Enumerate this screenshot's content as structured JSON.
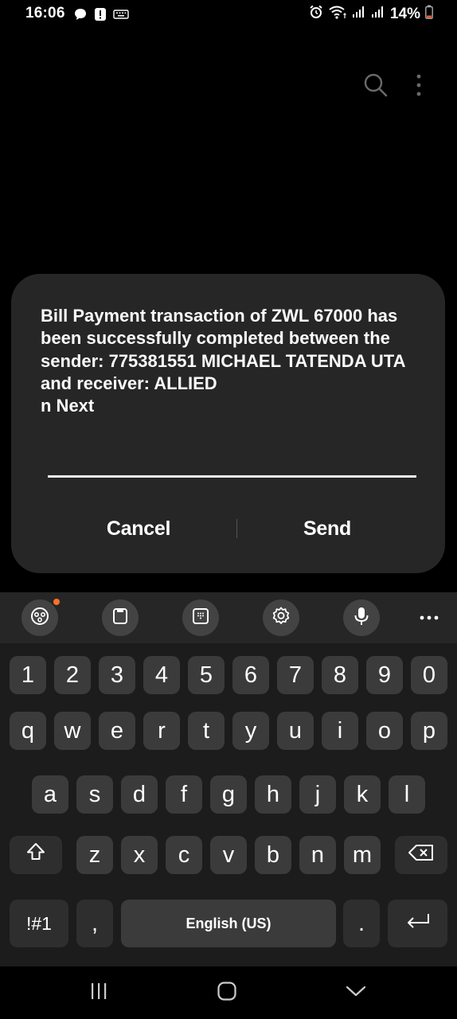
{
  "status_bar": {
    "time": "16:06",
    "battery": "14%",
    "left_icons": [
      "chat-bubble-icon",
      "alert-icon",
      "keyboard-icon"
    ],
    "right_icons": [
      "alarm-icon",
      "wifi-icon",
      "signal-icon",
      "signal-icon",
      "battery-low-icon"
    ]
  },
  "top_actions": {
    "icons": [
      "search-icon",
      "more-vertical-icon"
    ]
  },
  "dialog": {
    "message": "Bill Payment transaction of ZWL 67000 has been successfully completed between the sender: 775381551 MICHAEL TATENDA UTA and receiver: ALLIED\nn Next",
    "cancel_label": "Cancel",
    "send_label": "Send"
  },
  "keyboard": {
    "toolbar_icons": [
      "emoji-icon",
      "clipboard-icon",
      "keypad-icon",
      "settings-icon",
      "microphone-icon",
      "more-horizontal-icon"
    ],
    "number_row": [
      "1",
      "2",
      "3",
      "4",
      "5",
      "6",
      "7",
      "8",
      "9",
      "0"
    ],
    "row1": [
      "q",
      "w",
      "e",
      "r",
      "t",
      "y",
      "u",
      "i",
      "o",
      "p"
    ],
    "row2": [
      "a",
      "s",
      "d",
      "f",
      "g",
      "h",
      "j",
      "k",
      "l"
    ],
    "row3": [
      "z",
      "x",
      "c",
      "v",
      "b",
      "n",
      "m"
    ],
    "symbols_label": "!#1",
    "comma_label": ",",
    "space_label": "English (US)",
    "period_label": ".",
    "icons": [
      "shift-icon",
      "backspace-icon",
      "enter-icon"
    ],
    "accent_color": "#ff6f2c"
  },
  "nav_bar": {
    "icons": [
      "recent-apps-icon",
      "home-icon",
      "back-icon"
    ]
  }
}
